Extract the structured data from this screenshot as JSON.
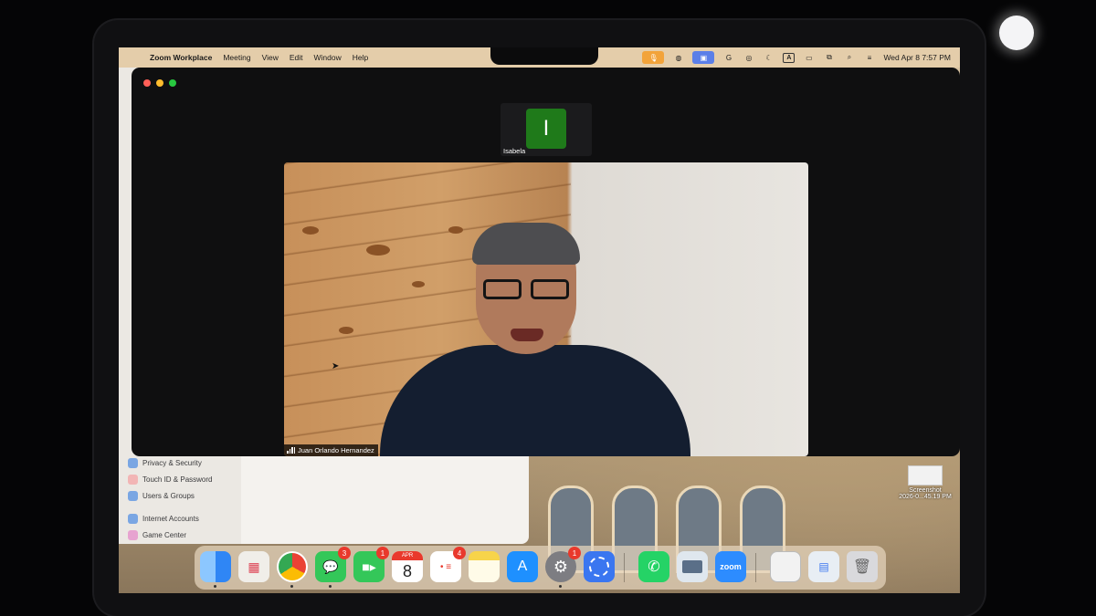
{
  "menubar": {
    "app_name": "Zoom Workplace",
    "items": [
      "Meeting",
      "View",
      "Edit",
      "Window",
      "Help"
    ],
    "clock": "Wed Apr 8  7:57 PM",
    "status_icons": [
      "mic-in-use-icon",
      "caption-icon",
      "screen-share-icon",
      "grammarly-icon",
      "airdrop-icon",
      "focus-moon-icon",
      "input-source-icon",
      "battery-icon",
      "screen-mirroring-icon",
      "spotlight-search-icon",
      "control-center-icon"
    ]
  },
  "settings_sidebar": {
    "items": [
      "Privacy & Security",
      "Touch ID & Password",
      "Users & Groups",
      "Internet Accounts",
      "Game Center"
    ]
  },
  "zoom": {
    "participants": [
      {
        "name": "Isabela",
        "initial": "I",
        "avatar_color": "#1f7a1a"
      },
      {
        "name": "Juan Orlando Hernandez"
      }
    ]
  },
  "desktop": {
    "file_name_line1": "Screenshot",
    "file_name_line2": "2026-0...45.19 PM"
  },
  "dock": {
    "apps": [
      {
        "name": "Finder",
        "icon": "finder-icon",
        "color": "#3b8ff0"
      },
      {
        "name": "Launchpad",
        "icon": "launchpad-icon",
        "color": "#f0eee9"
      },
      {
        "name": "Chrome",
        "icon": "chrome-icon",
        "color": "#ffffff"
      },
      {
        "name": "Messages",
        "icon": "messages-icon",
        "color": "#34c759",
        "badge": "3"
      },
      {
        "name": "FaceTime",
        "icon": "facetime-icon",
        "color": "#34c759",
        "badge": "1"
      },
      {
        "name": "Calendar",
        "icon": "calendar-icon",
        "month": "APR",
        "day": "8"
      },
      {
        "name": "Reminders",
        "icon": "reminders-icon",
        "color": "#ffffff",
        "badge": "4"
      },
      {
        "name": "Notes",
        "icon": "notes-icon",
        "color": "#f7d44a"
      },
      {
        "name": "App Store",
        "icon": "app-store-icon",
        "color": "#1e90ff"
      },
      {
        "name": "System Settings",
        "icon": "gear-icon",
        "color": "#7d7d82",
        "badge": "1"
      },
      {
        "name": "Signal",
        "icon": "signal-icon",
        "color": "#3a76f0"
      },
      {
        "name": "WhatsApp",
        "icon": "whatsapp-icon",
        "color": "#25d366"
      },
      {
        "name": "Preview",
        "icon": "preview-icon",
        "color": "#dfe7ee"
      },
      {
        "name": "Zoom",
        "icon": "zoom-icon",
        "color": "#2d8cff",
        "label": "zoom"
      },
      {
        "name": "Document",
        "icon": "document-icon",
        "color": "#f2f2f2"
      },
      {
        "name": "Downloads",
        "icon": "downloads-stack-icon",
        "color": "#e8eef4"
      },
      {
        "name": "Trash",
        "icon": "trash-icon",
        "color": "#d9d9dc"
      }
    ]
  }
}
